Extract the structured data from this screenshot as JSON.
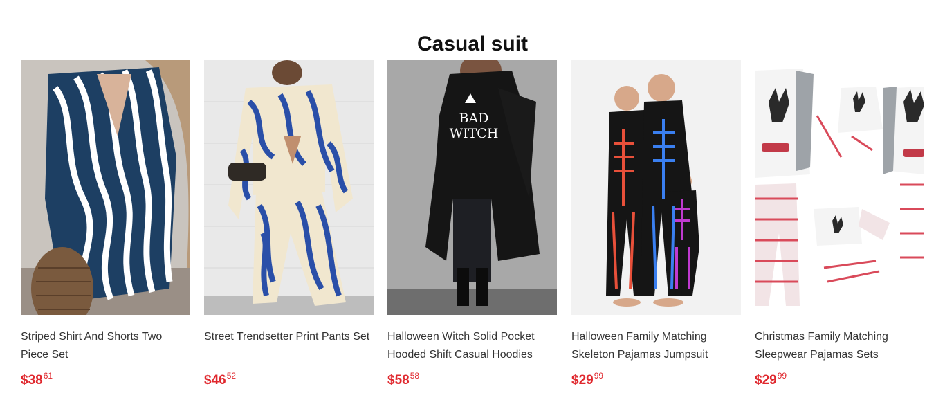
{
  "section": {
    "title": "Casual suit"
  },
  "products": [
    {
      "name": "Striped Shirt And Shorts Two Piece Set",
      "currency": "$",
      "price_int": "38",
      "price_dec": "61",
      "image": "striped-shirt-shorts-photo"
    },
    {
      "name": "Street Trendsetter Print Pants Set",
      "currency": "$",
      "price_int": "46",
      "price_dec": "52",
      "image": "zebra-print-pants-set-photo"
    },
    {
      "name": "Halloween Witch Solid Pocket Hooded Shift Casual Hoodies",
      "currency": "$",
      "price_int": "58",
      "price_dec": "58",
      "image": "bad-witch-hoodie-photo",
      "print_text": "BAD WITCH"
    },
    {
      "name": "Halloween Family Matching Skeleton Pajamas Jumpsuit",
      "currency": "$",
      "price_int": "29",
      "price_dec": "99",
      "image": "skeleton-family-pajamas-photo"
    },
    {
      "name": "Christmas Family Matching Sleepwear Pajamas Sets",
      "currency": "$",
      "price_int": "29",
      "price_dec": "99",
      "image": "christmas-reindeer-pajamas-photo"
    }
  ]
}
